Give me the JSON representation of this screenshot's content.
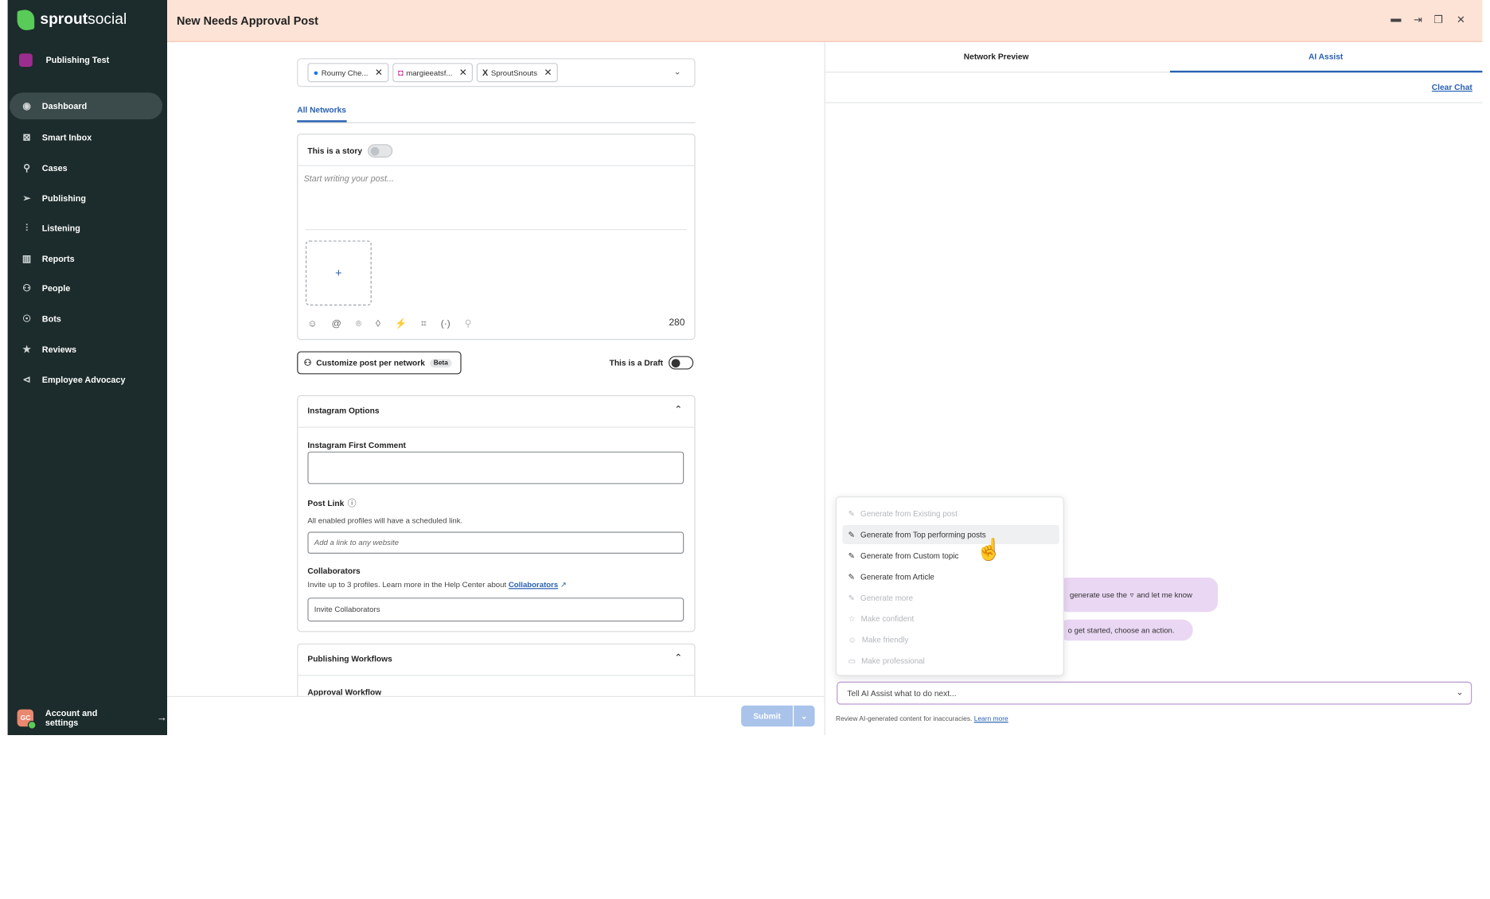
{
  "brand": {
    "name_bold": "sprout",
    "name_light": "social"
  },
  "workspace": "Publishing Test",
  "sidebar": {
    "items": [
      {
        "label": "Dashboard",
        "icon": "dashboard-icon"
      },
      {
        "label": "Smart Inbox",
        "icon": "inbox-icon"
      },
      {
        "label": "Cases",
        "icon": "pin-icon"
      },
      {
        "label": "Publishing",
        "icon": "paper-plane-icon"
      },
      {
        "label": "Listening",
        "icon": "listening-icon"
      },
      {
        "label": "Reports",
        "icon": "bar-chart-icon"
      },
      {
        "label": "People",
        "icon": "people-icon"
      },
      {
        "label": "Bots",
        "icon": "bot-icon"
      },
      {
        "label": "Reviews",
        "icon": "star-icon"
      },
      {
        "label": "Employee Advocacy",
        "icon": "megaphone-icon"
      }
    ],
    "account": {
      "initials": "GC",
      "label": "Account and settings",
      "arrow": "→"
    }
  },
  "header": {
    "title": "New Needs Approval Post"
  },
  "compose": {
    "profiles": [
      {
        "label": "Roumy Che...",
        "icon": "facebook-icon"
      },
      {
        "label": "margieeatsf...",
        "icon": "instagram-icon"
      },
      {
        "label": "SproutSnouts",
        "icon": "x-icon"
      }
    ],
    "tab_all": "All Networks",
    "story_label": "This is a story",
    "placeholder": "Start writing your post...",
    "add_media": "+",
    "char_count": "280",
    "customize_label": "Customize post per network",
    "beta": "Beta",
    "draft_label": "This is a Draft",
    "instagram_options": "Instagram Options",
    "first_comment_label": "Instagram First Comment",
    "post_link_label": "Post Link",
    "post_link_help": "All enabled profiles will have a scheduled link.",
    "post_link_placeholder": "Add a link to any website",
    "collab_label": "Collaborators",
    "collab_help": "Invite up to 3 profiles. Learn more in the Help Center about",
    "collab_link": "Collaborators",
    "collab_placeholder": "Invite Collaborators",
    "workflows": "Publishing Workflows",
    "approval": "Approval Workflow",
    "submit": "Submit"
  },
  "right": {
    "tab_preview": "Network Preview",
    "tab_ai": "AI Assist",
    "clear_chat": "Clear Chat",
    "menu": [
      {
        "label": "Generate from Existing post",
        "disabled": true
      },
      {
        "label": "Generate from Top performing posts",
        "disabled": false
      },
      {
        "label": "Generate from Custom topic",
        "disabled": false
      },
      {
        "label": "Generate from Article",
        "disabled": false
      },
      {
        "label": "Generate more",
        "disabled": true
      },
      {
        "label": "Make confident",
        "disabled": true
      },
      {
        "label": "Make friendly",
        "disabled": true
      },
      {
        "label": "Make professional",
        "disabled": true
      }
    ],
    "bubble1_pre": "generate use the",
    "bubble1_post": "and let me know",
    "bubble2": "o get started, choose an action.",
    "input_placeholder": "Tell AI Assist what to do next...",
    "disclaimer": "Review AI-generated content for inaccuracies.",
    "learn_more": "Learn more"
  }
}
